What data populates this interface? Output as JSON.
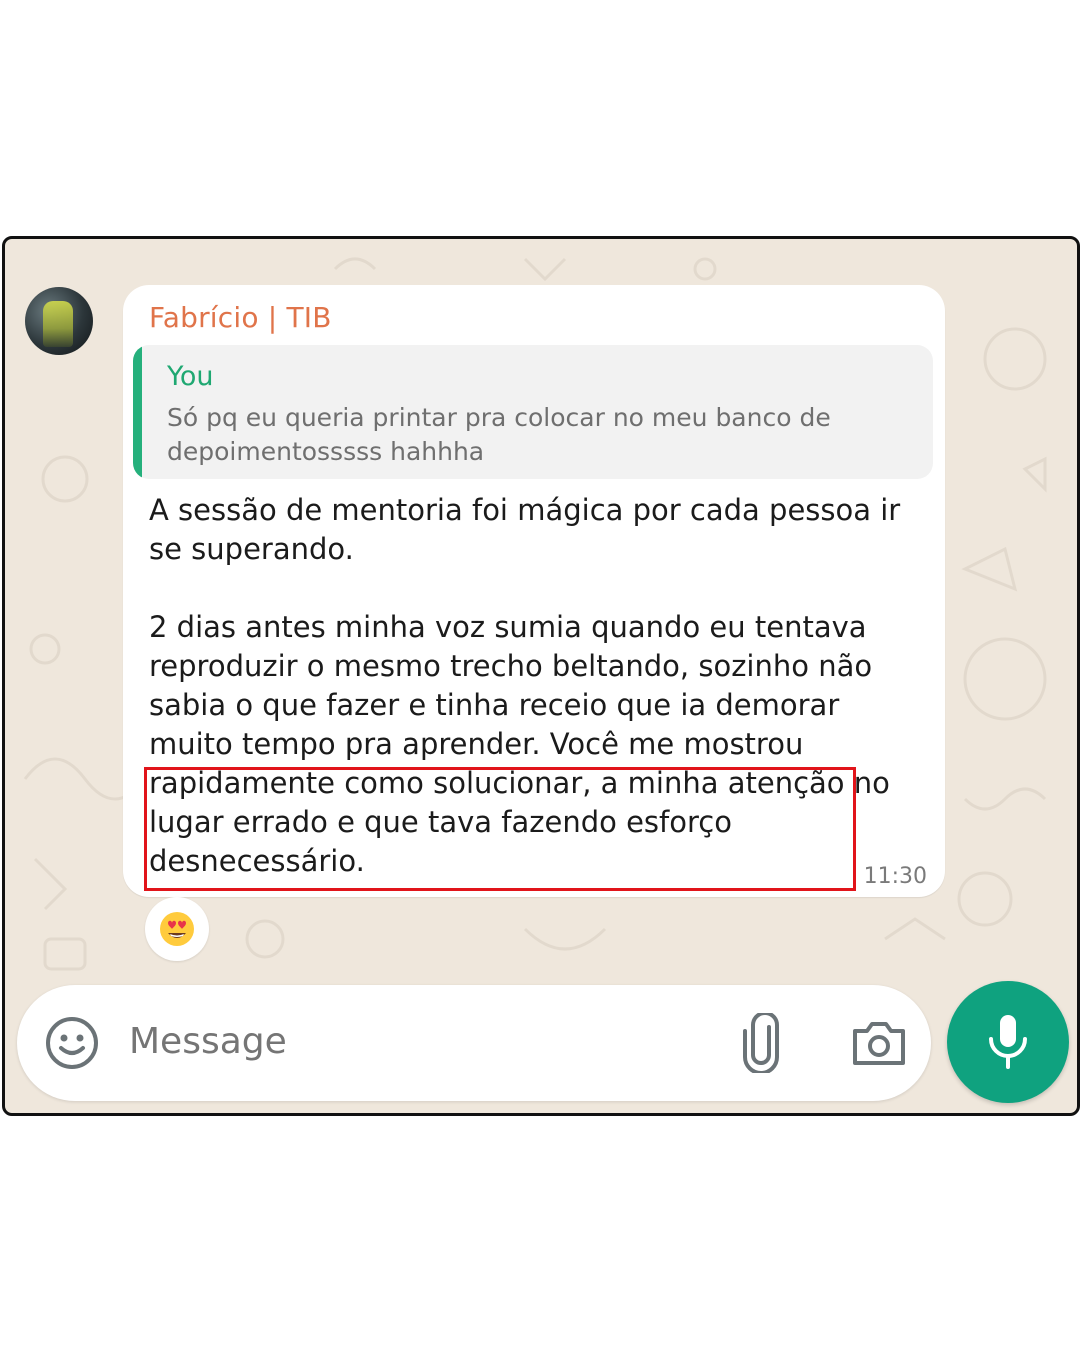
{
  "chat": {
    "sender_name": "Fabrício | TIB",
    "reply": {
      "author": "You",
      "text": "Só pq eu queria printar pra colocar no meu banco de depoimentosssss hahhha"
    },
    "message_text": "A sessão de mentoria foi mágica por cada pessoa ir se superando.\n\n2 dias antes minha voz sumia quando eu tentava reproduzir o mesmo trecho beltando, sozinho não sabia o que fazer e tinha receio que ia demorar muito tempo pra aprender. Você me mostrou rapidamente como solucionar, a minha atenção no lugar errado e que tava fazendo esforço desnecessário.",
    "timestamp": "11:30",
    "reaction": "heart-eyes-emoji"
  },
  "composer": {
    "placeholder": "Message",
    "icons": [
      "emoji-icon",
      "paperclip-icon",
      "camera-icon",
      "mic-icon"
    ]
  },
  "colors": {
    "sender_name": "#e0744a",
    "reply_accent": "#25b07c",
    "mic_button": "#0fa27f",
    "highlight_box": "#e1141a",
    "chat_background": "#efe7dc"
  }
}
